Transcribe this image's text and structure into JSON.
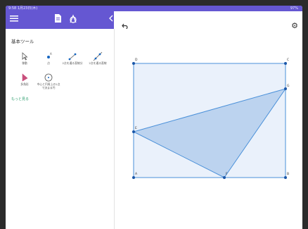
{
  "statusbar": {
    "time": "9:58 1月23日(木)",
    "right": "97%"
  },
  "toolbar": {
    "menu_icon": "menu-icon",
    "doc_icon": "document-icon",
    "tools_icon": "geometry-tools-icon",
    "collapse_icon": "chevron-left-icon"
  },
  "sidebar": {
    "title": "基本ツール",
    "tools": [
      {
        "label": "移動",
        "icon": "move-arrow-icon"
      },
      {
        "label": "点",
        "icon": "point-icon"
      },
      {
        "label": "2点を通る直線分",
        "icon": "segment-icon"
      },
      {
        "label": "2点を通る直線",
        "icon": "line-icon"
      },
      {
        "label": "多角形",
        "icon": "polygon-icon"
      },
      {
        "label": "中心と円周上の1点で決まる円",
        "icon": "circle-icon"
      }
    ],
    "more_label": "もっと見る"
  },
  "canvas": {
    "undo_icon": "undo-icon",
    "settings_icon": "gear-icon",
    "points": [
      "D",
      "C",
      "G",
      "E",
      "A",
      "F",
      "B"
    ]
  },
  "colors": {
    "accent": "#6557d2",
    "shape_stroke": "#4a90d9",
    "shape_fill": "#dce8f8",
    "triangle_fill": "#bcd3ef"
  }
}
